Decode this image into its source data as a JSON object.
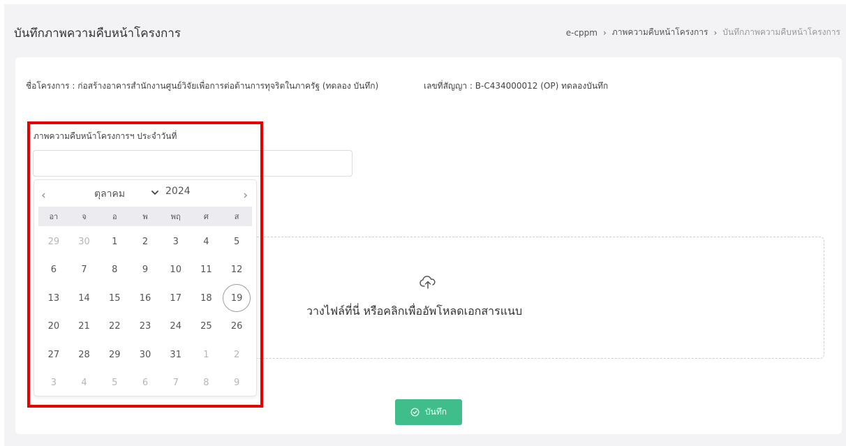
{
  "page": {
    "title": "บันทึกภาพความคืบหน้าโครงการ"
  },
  "breadcrumb": {
    "items": [
      "e-cppm",
      "ภาพความคืบหน้าโครงการ",
      "บันทึกภาพความคืบหน้าโครงการ"
    ]
  },
  "project": {
    "name_line": "ชื่อโครงการ : ก่อสร้างอาคารสำนักงานศูนย์วิจัยเพื่อการต่อต้านการทุจริตในภาครัฐ (ทดลอง บันทึก)",
    "contract_line": "เลขที่สัญญา : B-C434000012 (OP) ทดลองบันทึก"
  },
  "date_field": {
    "label": "ภาพความคืบหน้าโครงการฯ ประจำวันที่",
    "value": ""
  },
  "calendar": {
    "prev_icon": "‹",
    "next_icon": "›",
    "month": "ตุลาคม",
    "year": "2024",
    "weekdays": [
      "อา",
      "จ",
      "อ",
      "พ",
      "พฤ",
      "ศ",
      "ส"
    ],
    "today": "19",
    "weeks": [
      [
        {
          "d": "29",
          "m": true
        },
        {
          "d": "30",
          "m": true
        },
        {
          "d": "1"
        },
        {
          "d": "2"
        },
        {
          "d": "3"
        },
        {
          "d": "4"
        },
        {
          "d": "5"
        }
      ],
      [
        {
          "d": "6"
        },
        {
          "d": "7"
        },
        {
          "d": "8"
        },
        {
          "d": "9"
        },
        {
          "d": "10"
        },
        {
          "d": "11"
        },
        {
          "d": "12"
        }
      ],
      [
        {
          "d": "13"
        },
        {
          "d": "14"
        },
        {
          "d": "15"
        },
        {
          "d": "16"
        },
        {
          "d": "17"
        },
        {
          "d": "18"
        },
        {
          "d": "19",
          "t": true
        }
      ],
      [
        {
          "d": "20"
        },
        {
          "d": "21"
        },
        {
          "d": "22"
        },
        {
          "d": "23"
        },
        {
          "d": "24"
        },
        {
          "d": "25"
        },
        {
          "d": "26"
        }
      ],
      [
        {
          "d": "27"
        },
        {
          "d": "28"
        },
        {
          "d": "29"
        },
        {
          "d": "30"
        },
        {
          "d": "31"
        },
        {
          "d": "1",
          "m": true
        },
        {
          "d": "2",
          "m": true
        }
      ],
      [
        {
          "d": "3",
          "m": true
        },
        {
          "d": "4",
          "m": true
        },
        {
          "d": "5",
          "m": true
        },
        {
          "d": "6",
          "m": true
        },
        {
          "d": "7",
          "m": true
        },
        {
          "d": "8",
          "m": true
        },
        {
          "d": "9",
          "m": true
        }
      ]
    ]
  },
  "dropzone": {
    "icon": "cloud-upload-icon",
    "text": "วางไฟล์ที่นี่ หรือคลิกเพื่ออัพโหลดเอกสารแนบ"
  },
  "actions": {
    "save_label": "บันทึก",
    "save_icon": "check-circle-icon",
    "save_color": "#3fbd8b"
  },
  "colors": {
    "highlight": "#e60000",
    "background": "#f3f3f6"
  }
}
